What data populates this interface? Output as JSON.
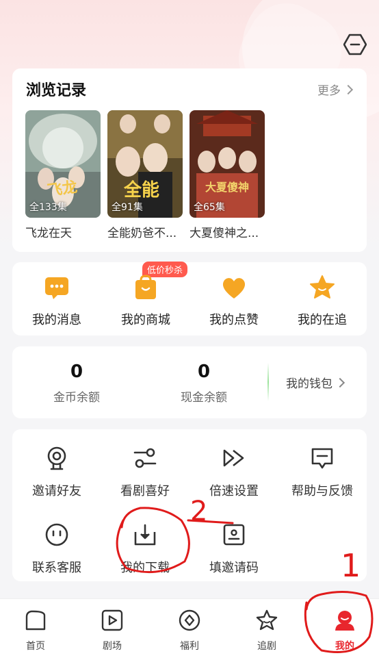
{
  "history": {
    "title": "浏览记录",
    "more": "更多",
    "items": [
      {
        "name": "飞龙在天",
        "episodes": "全133集"
      },
      {
        "name": "全能奶爸不...",
        "episodes": "全91集"
      },
      {
        "name": "大夏傻神之...",
        "episodes": "全65集"
      }
    ]
  },
  "features": {
    "badge": "低价秒杀",
    "items": [
      {
        "label": "我的消息",
        "icon": "message-icon"
      },
      {
        "label": "我的商城",
        "icon": "shopping-bag-icon"
      },
      {
        "label": "我的点赞",
        "icon": "heart-icon"
      },
      {
        "label": "我的在追",
        "icon": "star-icon"
      }
    ]
  },
  "wallet": {
    "coins_value": "0",
    "coins_label": "金币余额",
    "cash_value": "0",
    "cash_label": "现金余额",
    "wallet_link": "我的钱包"
  },
  "tools": {
    "items": [
      {
        "label": "邀请好友",
        "icon": "invite-icon"
      },
      {
        "label": "看剧喜好",
        "icon": "preference-icon"
      },
      {
        "label": "倍速设置",
        "icon": "speed-icon"
      },
      {
        "label": "帮助与反馈",
        "icon": "feedback-icon"
      },
      {
        "label": "联系客服",
        "icon": "customer-service-icon"
      },
      {
        "label": "我的下载",
        "icon": "download-icon"
      },
      {
        "label": "填邀请码",
        "icon": "invite-code-icon"
      }
    ]
  },
  "nav": {
    "items": [
      {
        "label": "首页",
        "icon": "home-icon"
      },
      {
        "label": "剧场",
        "icon": "theater-icon"
      },
      {
        "label": "福利",
        "icon": "welfare-icon"
      },
      {
        "label": "追剧",
        "icon": "follow-icon"
      },
      {
        "label": "我的",
        "icon": "profile-icon"
      }
    ],
    "active_color": "#e8262d"
  },
  "annotations": {
    "mark_1": "1",
    "mark_2": "2"
  }
}
